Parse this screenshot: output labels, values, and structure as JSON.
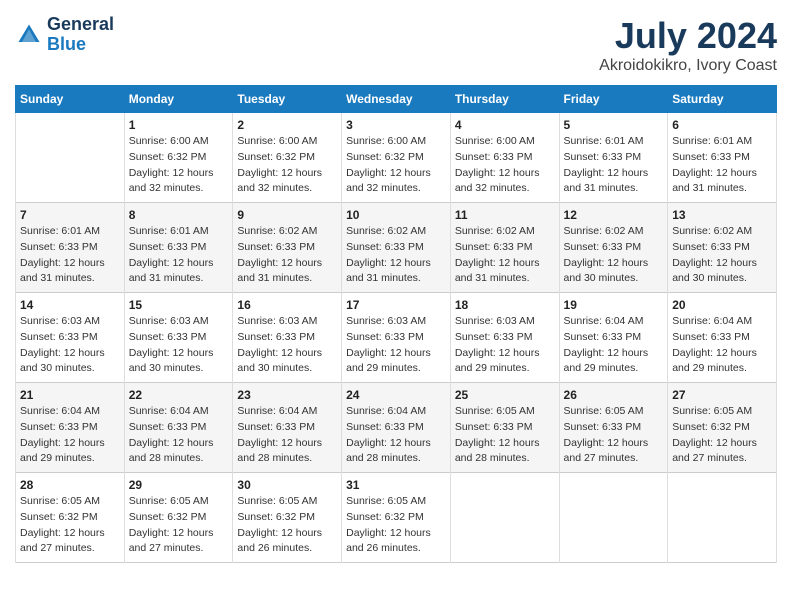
{
  "logo": {
    "text1": "General",
    "text2": "Blue"
  },
  "title": "July 2024",
  "subtitle": "Akroidokikro, Ivory Coast",
  "days_header": [
    "Sunday",
    "Monday",
    "Tuesday",
    "Wednesday",
    "Thursday",
    "Friday",
    "Saturday"
  ],
  "weeks": [
    [
      {
        "day": "",
        "info": ""
      },
      {
        "day": "1",
        "info": "Sunrise: 6:00 AM\nSunset: 6:32 PM\nDaylight: 12 hours\nand 32 minutes."
      },
      {
        "day": "2",
        "info": "Sunrise: 6:00 AM\nSunset: 6:32 PM\nDaylight: 12 hours\nand 32 minutes."
      },
      {
        "day": "3",
        "info": "Sunrise: 6:00 AM\nSunset: 6:32 PM\nDaylight: 12 hours\nand 32 minutes."
      },
      {
        "day": "4",
        "info": "Sunrise: 6:00 AM\nSunset: 6:33 PM\nDaylight: 12 hours\nand 32 minutes."
      },
      {
        "day": "5",
        "info": "Sunrise: 6:01 AM\nSunset: 6:33 PM\nDaylight: 12 hours\nand 31 minutes."
      },
      {
        "day": "6",
        "info": "Sunrise: 6:01 AM\nSunset: 6:33 PM\nDaylight: 12 hours\nand 31 minutes."
      }
    ],
    [
      {
        "day": "7",
        "info": "Sunrise: 6:01 AM\nSunset: 6:33 PM\nDaylight: 12 hours\nand 31 minutes."
      },
      {
        "day": "8",
        "info": "Sunrise: 6:01 AM\nSunset: 6:33 PM\nDaylight: 12 hours\nand 31 minutes."
      },
      {
        "day": "9",
        "info": "Sunrise: 6:02 AM\nSunset: 6:33 PM\nDaylight: 12 hours\nand 31 minutes."
      },
      {
        "day": "10",
        "info": "Sunrise: 6:02 AM\nSunset: 6:33 PM\nDaylight: 12 hours\nand 31 minutes."
      },
      {
        "day": "11",
        "info": "Sunrise: 6:02 AM\nSunset: 6:33 PM\nDaylight: 12 hours\nand 31 minutes."
      },
      {
        "day": "12",
        "info": "Sunrise: 6:02 AM\nSunset: 6:33 PM\nDaylight: 12 hours\nand 30 minutes."
      },
      {
        "day": "13",
        "info": "Sunrise: 6:02 AM\nSunset: 6:33 PM\nDaylight: 12 hours\nand 30 minutes."
      }
    ],
    [
      {
        "day": "14",
        "info": "Sunrise: 6:03 AM\nSunset: 6:33 PM\nDaylight: 12 hours\nand 30 minutes."
      },
      {
        "day": "15",
        "info": "Sunrise: 6:03 AM\nSunset: 6:33 PM\nDaylight: 12 hours\nand 30 minutes."
      },
      {
        "day": "16",
        "info": "Sunrise: 6:03 AM\nSunset: 6:33 PM\nDaylight: 12 hours\nand 30 minutes."
      },
      {
        "day": "17",
        "info": "Sunrise: 6:03 AM\nSunset: 6:33 PM\nDaylight: 12 hours\nand 29 minutes."
      },
      {
        "day": "18",
        "info": "Sunrise: 6:03 AM\nSunset: 6:33 PM\nDaylight: 12 hours\nand 29 minutes."
      },
      {
        "day": "19",
        "info": "Sunrise: 6:04 AM\nSunset: 6:33 PM\nDaylight: 12 hours\nand 29 minutes."
      },
      {
        "day": "20",
        "info": "Sunrise: 6:04 AM\nSunset: 6:33 PM\nDaylight: 12 hours\nand 29 minutes."
      }
    ],
    [
      {
        "day": "21",
        "info": "Sunrise: 6:04 AM\nSunset: 6:33 PM\nDaylight: 12 hours\nand 29 minutes."
      },
      {
        "day": "22",
        "info": "Sunrise: 6:04 AM\nSunset: 6:33 PM\nDaylight: 12 hours\nand 28 minutes."
      },
      {
        "day": "23",
        "info": "Sunrise: 6:04 AM\nSunset: 6:33 PM\nDaylight: 12 hours\nand 28 minutes."
      },
      {
        "day": "24",
        "info": "Sunrise: 6:04 AM\nSunset: 6:33 PM\nDaylight: 12 hours\nand 28 minutes."
      },
      {
        "day": "25",
        "info": "Sunrise: 6:05 AM\nSunset: 6:33 PM\nDaylight: 12 hours\nand 28 minutes."
      },
      {
        "day": "26",
        "info": "Sunrise: 6:05 AM\nSunset: 6:33 PM\nDaylight: 12 hours\nand 27 minutes."
      },
      {
        "day": "27",
        "info": "Sunrise: 6:05 AM\nSunset: 6:32 PM\nDaylight: 12 hours\nand 27 minutes."
      }
    ],
    [
      {
        "day": "28",
        "info": "Sunrise: 6:05 AM\nSunset: 6:32 PM\nDaylight: 12 hours\nand 27 minutes."
      },
      {
        "day": "29",
        "info": "Sunrise: 6:05 AM\nSunset: 6:32 PM\nDaylight: 12 hours\nand 27 minutes."
      },
      {
        "day": "30",
        "info": "Sunrise: 6:05 AM\nSunset: 6:32 PM\nDaylight: 12 hours\nand 26 minutes."
      },
      {
        "day": "31",
        "info": "Sunrise: 6:05 AM\nSunset: 6:32 PM\nDaylight: 12 hours\nand 26 minutes."
      },
      {
        "day": "",
        "info": ""
      },
      {
        "day": "",
        "info": ""
      },
      {
        "day": "",
        "info": ""
      }
    ]
  ]
}
